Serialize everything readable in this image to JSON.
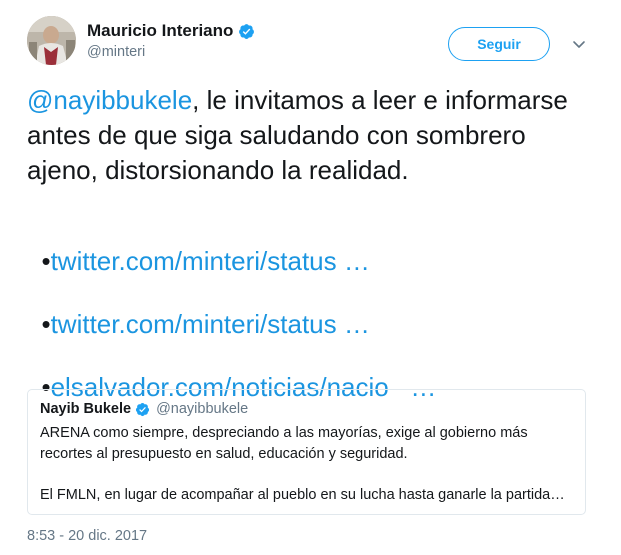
{
  "author": {
    "display_name": "Mauricio Interiano",
    "handle": "@minteri",
    "verified": true
  },
  "follow_button": {
    "label": "Seguir"
  },
  "tweet": {
    "mention": "@nayibbukele",
    "text": ", le invitamos a leer e informarse antes de que siga saludando con sombrero ajeno, distorsionando la realidad.",
    "bullet": "•",
    "links": [
      {
        "text": "twitter.com/minteri/status …"
      },
      {
        "text": "twitter.com/minteri/status …"
      },
      {
        "text": "elsalvador.com/noticias/nacio   …"
      }
    ]
  },
  "quoted_tweet": {
    "display_name": "Nayib Bukele",
    "handle": "@nayibbukele",
    "verified": true,
    "paragraph1": "ARENA como siempre, despreciando a las mayorías, exige al gobierno más recortes al presupuesto en salud, educación y seguridad.",
    "paragraph2": "El FMLN, en lugar de acompañar al pueblo en su lucha hasta ganarle la partida…"
  },
  "timestamp": "8:53 - 20 dic. 2017",
  "colors": {
    "accent": "#1da1f2",
    "link": "#1b95e0",
    "secondary_text": "#657786"
  },
  "icons": {
    "verified": "verified-badge-icon",
    "more": "chevron-down-icon"
  }
}
